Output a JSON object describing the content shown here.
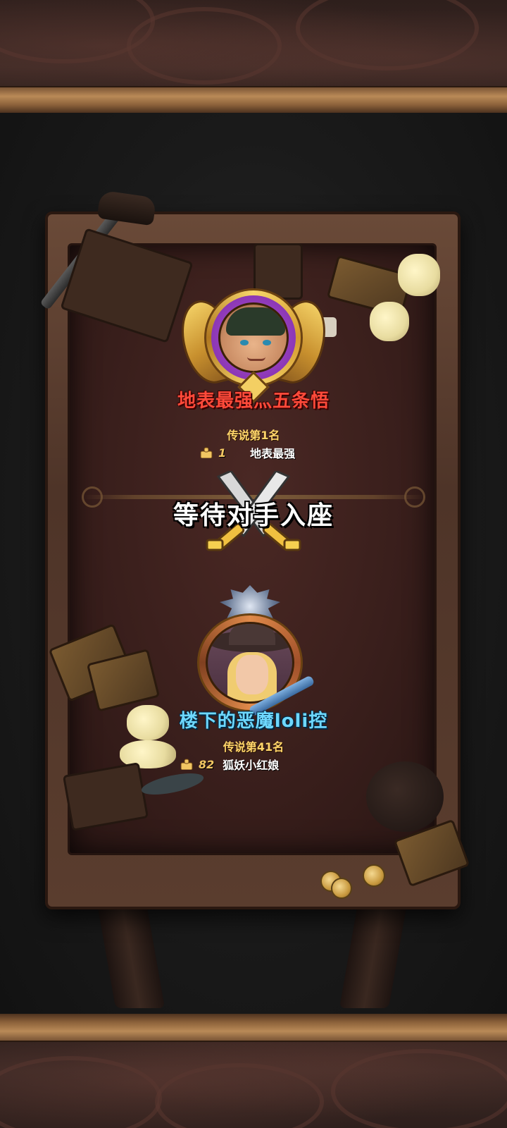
{
  "player_top": {
    "name": "地表最强灬五条悟",
    "rank": "传说第1名",
    "trophies": "1",
    "title": "地表最强",
    "avatar": "boy-hero-avatar"
  },
  "center": {
    "status": "等待对手入座",
    "icon": "crossed-swords-icon"
  },
  "player_bottom": {
    "name": "楼下的恶魔loli控",
    "rank": "传说第41名",
    "trophies": "82",
    "title": "狐妖小红娘",
    "avatar": "witch-girl-avatar"
  },
  "colors": {
    "name_top": "#ff4a3a",
    "name_bottom": "#6ed8ff",
    "rank": "#ffd56a",
    "trophy": "#f2c662"
  }
}
